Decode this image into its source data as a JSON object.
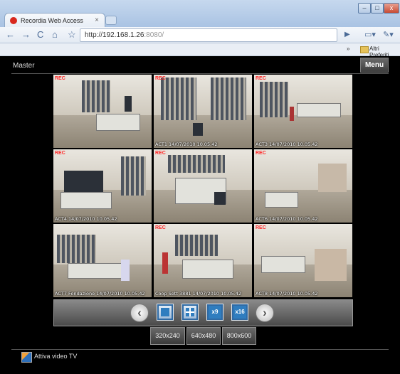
{
  "browser": {
    "tab_title": "Recordia Web Access",
    "tab_close": "×",
    "url_host": "http://192.168.1.26",
    "url_port": ":8080/",
    "bookmarks_chevron": "»",
    "bookmarks_folder": "Altri Preferiti",
    "window_controls": [
      "–",
      "□",
      "x"
    ]
  },
  "page": {
    "view_label": "Master",
    "menu_label": "Menu",
    "layout_buttons": [
      "",
      "",
      "x9",
      "x16"
    ],
    "resolutions": [
      "320x240",
      "640x480",
      "800x600"
    ],
    "footer_link": "Attiva video TV"
  },
  "cameras": [
    {
      "rec": "REC",
      "caption": ""
    },
    {
      "rec": "REC",
      "caption": "ACT1 14/07/2010 10.05.42"
    },
    {
      "rec": "REC",
      "caption": "ACT3 14/07/2010 10.05.42"
    },
    {
      "rec": "REC",
      "caption": "ACT4 14/07/2010 10.05.42"
    },
    {
      "rec": "REC",
      "caption": ""
    },
    {
      "rec": "REC",
      "caption": "ACT6 14/07/2010 10.05.42"
    },
    {
      "rec": "",
      "caption": "ACT7 Fondazione 14/07/2010 10.05.42"
    },
    {
      "rec": "REC",
      "caption": "Coop Sett 3881 14/07/2010 10.05.42"
    },
    {
      "rec": "REC",
      "caption": "ACT8 14/07/2010 10.05.42"
    }
  ],
  "colors": {
    "page_bg": "#000000",
    "chrome_blue": "#a9c3e3",
    "rec_red": "#ff2a2a",
    "layout_blue": "#2f7dbf"
  },
  "icons": [
    "back-icon",
    "forward-icon",
    "reload-icon",
    "home-icon",
    "star-icon",
    "go-icon",
    "page-icon",
    "wrench-icon",
    "arrow-left-icon",
    "arrow-right-icon",
    "tv-icon"
  ]
}
